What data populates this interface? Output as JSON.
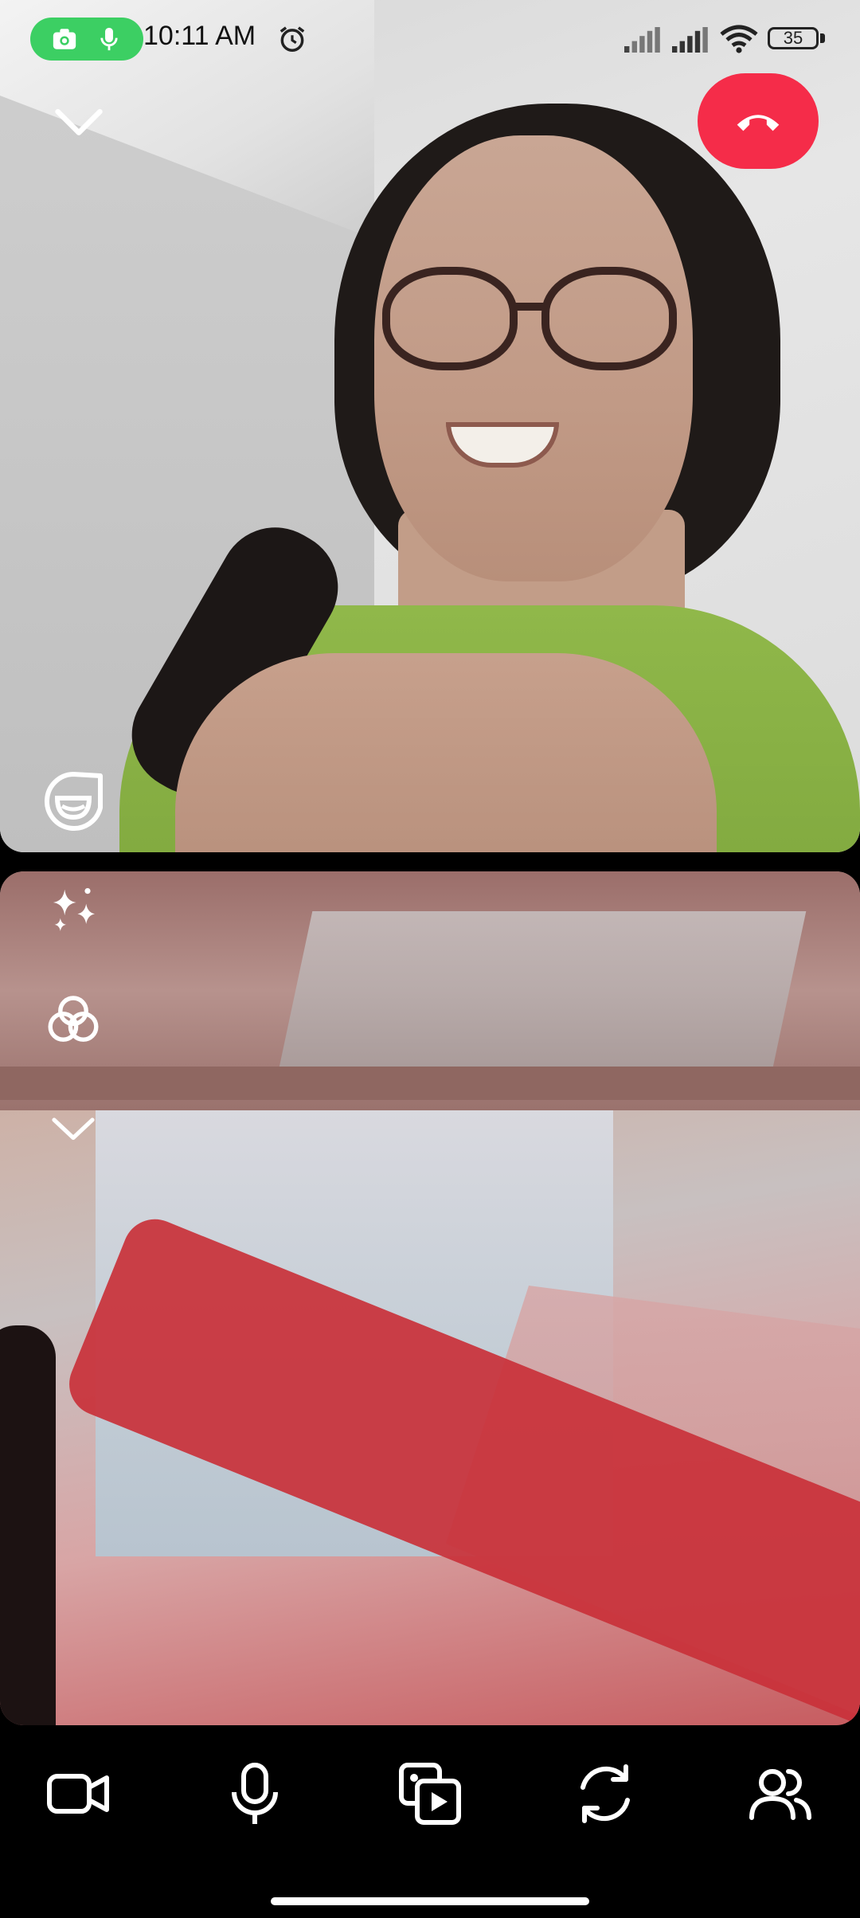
{
  "status_bar": {
    "time": "10:11 AM",
    "battery_level": "35",
    "recording_indicator_icons": [
      "camera-icon",
      "mic-icon"
    ],
    "recording_indicator_color": "#3ccf63"
  },
  "remote_video": {
    "collapse_icon": "chevron-down-icon",
    "end_call_icon": "phone-hangup-icon",
    "end_call_color": "#f52c49",
    "reactions_icon": "sticker-face-icon"
  },
  "self_video": {
    "effects_icon": "sparkles-icon",
    "filters_icon": "filters-icon",
    "collapse_icon": "chevron-down-icon"
  },
  "controls": [
    {
      "name": "video",
      "icon": "video-camera-icon"
    },
    {
      "name": "microphone",
      "icon": "mic-icon"
    },
    {
      "name": "share-media",
      "icon": "media-share-icon"
    },
    {
      "name": "flip-camera",
      "icon": "camera-flip-icon"
    },
    {
      "name": "participants",
      "icon": "people-icon"
    }
  ]
}
